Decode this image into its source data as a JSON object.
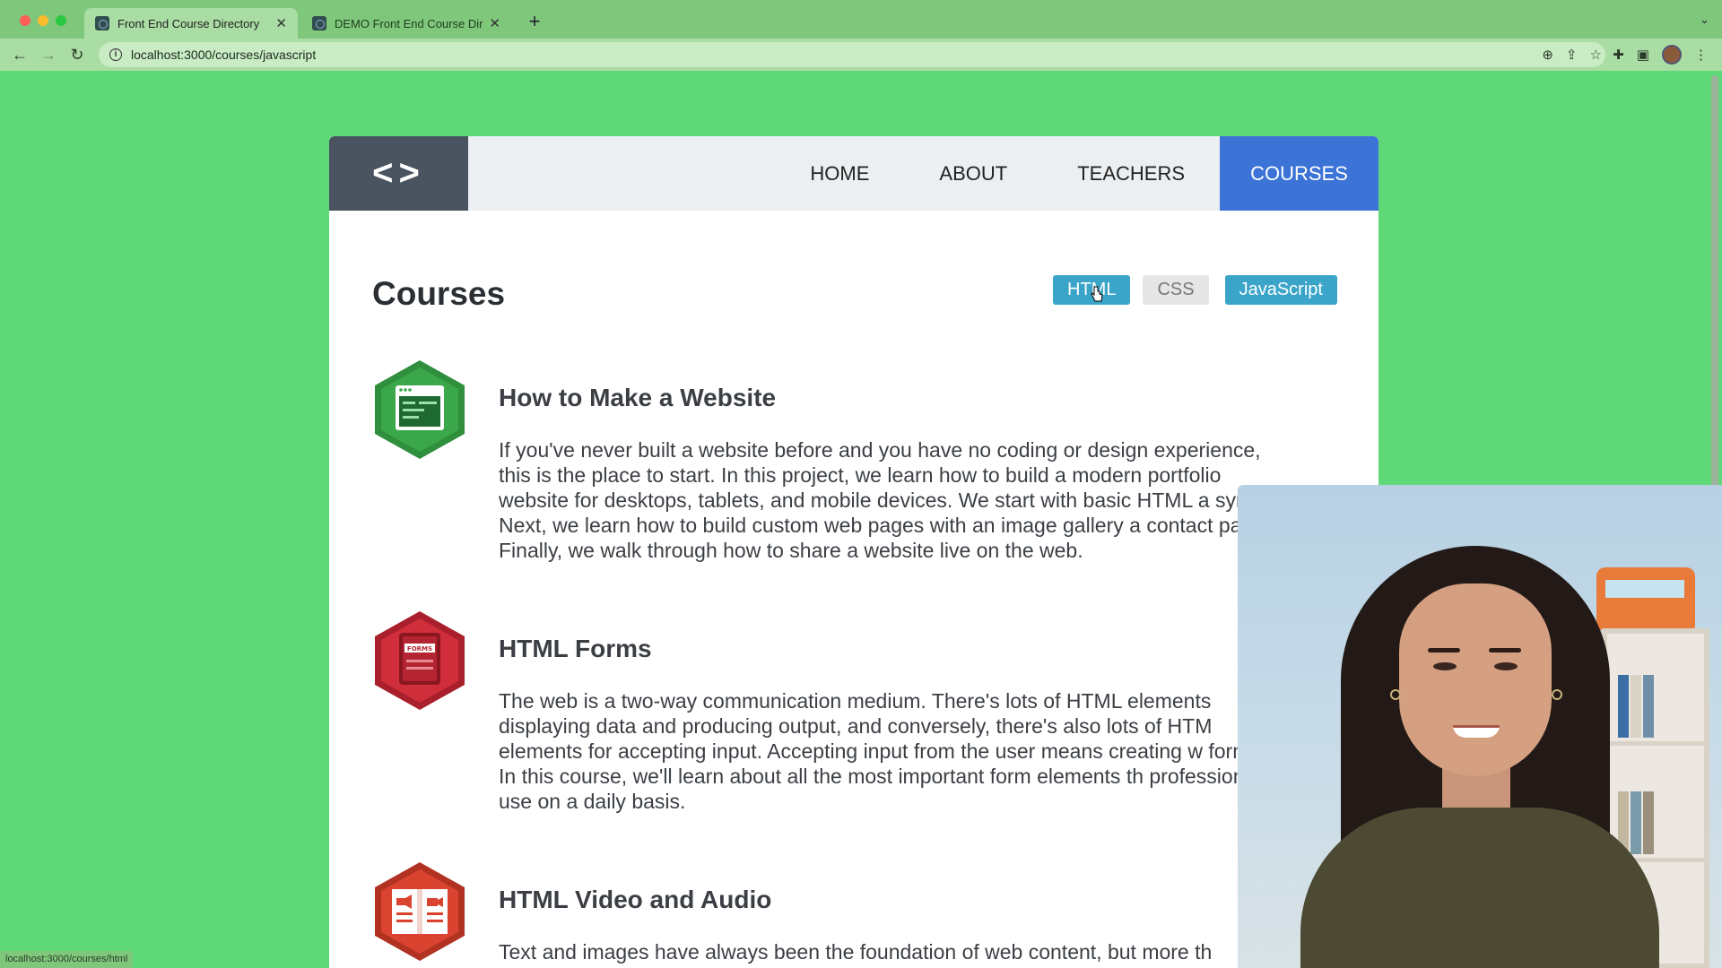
{
  "browser": {
    "tabs": [
      {
        "title": "Front End Course Directory",
        "active": true
      },
      {
        "title": "DEMO Front End Course Direc",
        "active": false
      }
    ],
    "url": "localhost:3000/courses/javascript",
    "status_url": "localhost:3000/courses/html"
  },
  "site": {
    "logo": "<>",
    "nav": [
      "HOME",
      "ABOUT",
      "TEACHERS",
      "COURSES"
    ],
    "active_nav": "COURSES"
  },
  "courses_page": {
    "title": "Courses",
    "filters": [
      "HTML",
      "CSS",
      "JavaScript"
    ],
    "items": [
      {
        "title": "How to Make a Website",
        "description": "If you've never built a website before and you have no coding or design experience, this is the place to start. In this project, we learn how to build a modern portfolio website for desktops, tablets, and mobile devices. We start with basic HTML a syntax. Next, we learn how to build custom web pages with an image gallery a contact page. Finally, we walk through how to share a website live on the web.",
        "badge_icon": "browser-window-icon",
        "badge_color": "#3aa84a"
      },
      {
        "title": "HTML Forms",
        "description": "The web is a two-way communication medium. There's lots of HTML elements displaying data and producing output, and conversely, there's also lots of HTM elements for accepting input. Accepting input from the user means creating w forms. In this course, we'll learn about all the most important form elements th professionals use on a daily basis.",
        "badge_icon": "forms-icon",
        "badge_label": "FORMS",
        "badge_color": "#cf2e3a"
      },
      {
        "title": "HTML Video and Audio",
        "description": "Text and images have always been the foundation of web content, but more th",
        "badge_icon": "video-audio-book-icon",
        "badge_color": "#d9432f"
      }
    ]
  },
  "colors": {
    "page_bg": "#5fd977",
    "nav_active": "#3b73d6",
    "filter_active": "#3aa5c9",
    "logo_bg": "#4a5461"
  }
}
